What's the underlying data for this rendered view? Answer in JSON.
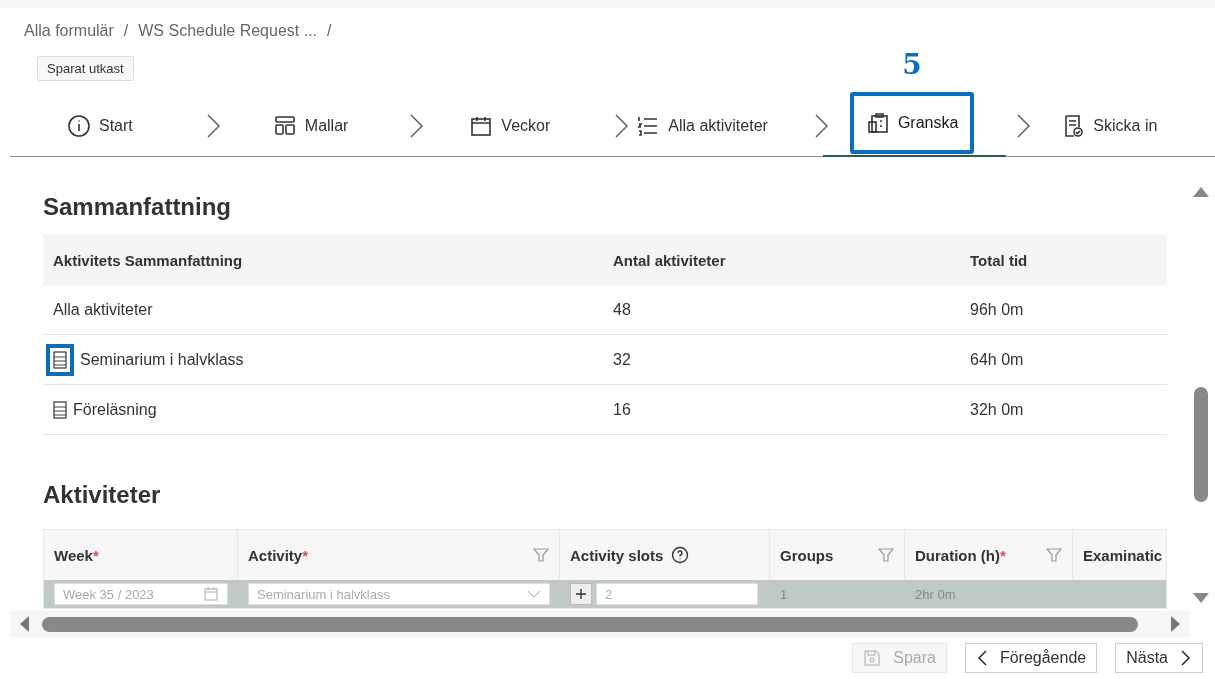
{
  "breadcrumb": {
    "separator": "/",
    "items": [
      {
        "label": "Alla formulär"
      },
      {
        "label": "WS Schedule Request ..."
      }
    ]
  },
  "status_badge": "Sparat utkast",
  "steps": [
    {
      "label": "Start",
      "kind": "info",
      "selected": false,
      "highlighted": false
    },
    {
      "label": "Mallar",
      "kind": "templates",
      "selected": false,
      "highlighted": false
    },
    {
      "label": "Veckor",
      "kind": "calendar",
      "selected": false,
      "highlighted": false
    },
    {
      "label": "Alla aktiviteter",
      "kind": "list",
      "selected": false,
      "highlighted": false
    },
    {
      "label": "Granska",
      "kind": "review",
      "selected": true,
      "highlighted": true
    },
    {
      "label": "Skicka in",
      "kind": "submit",
      "selected": false,
      "highlighted": false
    }
  ],
  "annotation": {
    "label": "5"
  },
  "summary": {
    "title": "Sammanfattning",
    "columns": [
      "Aktivitets Sammanfattning",
      "Antal aktiviteter",
      "Total tid"
    ],
    "rows": [
      {
        "kind": "total",
        "cells": [
          "Alla aktiviteter",
          "48",
          "96h 0m"
        ]
      },
      {
        "kind": "activity",
        "icon_highlighted": true,
        "cells": [
          "Seminarium i halvklass",
          "32",
          "64h 0m"
        ]
      },
      {
        "kind": "activity",
        "icon_highlighted": false,
        "cells": [
          "Föreläsning",
          "16",
          "32h 0m"
        ]
      }
    ]
  },
  "activities": {
    "title": "Aktiviteter",
    "columns": [
      {
        "label": "Week",
        "required_marker": "*",
        "filter": false,
        "help": false
      },
      {
        "label": "Activity",
        "required_marker": "*",
        "filter": true,
        "help": false
      },
      {
        "label": "Activity slots",
        "filter": false,
        "help": true
      },
      {
        "label": "Groups",
        "filter": true,
        "help": false
      },
      {
        "label": "Duration (h)",
        "required_marker": "*",
        "filter": true,
        "help": false
      },
      {
        "label": "Examinatic"
      }
    ],
    "rows": [
      {
        "week": "Week 35 / 2023",
        "activity": "Seminarium i halvklass",
        "slots": "2",
        "groups": "1",
        "duration": "2hr 0m"
      }
    ]
  },
  "footer": {
    "buttons": [
      {
        "label": "Spara",
        "kind": "save",
        "disabled": true
      },
      {
        "label": "Föregående",
        "kind": "prev",
        "disabled": false
      },
      {
        "label": "Nästa",
        "kind": "next",
        "disabled": false
      }
    ]
  }
}
